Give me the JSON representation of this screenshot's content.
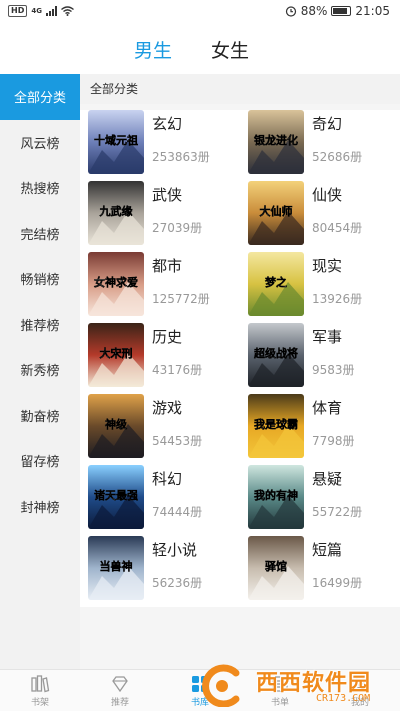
{
  "status_bar": {
    "hd": "HD",
    "network": "4G",
    "battery": "88%",
    "time": "21:05"
  },
  "gender_tabs": [
    {
      "label": "男生",
      "active": true
    },
    {
      "label": "女生",
      "active": false
    }
  ],
  "rail": {
    "items": [
      {
        "label": "全部分类",
        "active": true
      },
      {
        "label": "风云榜"
      },
      {
        "label": "热搜榜"
      },
      {
        "label": "完结榜"
      },
      {
        "label": "畅销榜"
      },
      {
        "label": "推荐榜"
      },
      {
        "label": "新秀榜"
      },
      {
        "label": "勤奋榜"
      },
      {
        "label": "留存榜"
      },
      {
        "label": "封神榜"
      }
    ]
  },
  "section_title": "全部分类",
  "categories": [
    {
      "name": "玄幻",
      "count": "253863册",
      "cover_title": "十域元祖",
      "colors": [
        "#2a3a6a",
        "#6d7fb8",
        "#c9d3f0"
      ]
    },
    {
      "name": "奇幻",
      "count": "52686册",
      "cover_title": "银龙进化",
      "colors": [
        "#2c2f3a",
        "#7a6a52",
        "#d9c39a"
      ]
    },
    {
      "name": "武侠",
      "count": "27039册",
      "cover_title": "九武缘",
      "colors": [
        "#e9e4d8",
        "#a9a39a",
        "#333333"
      ]
    },
    {
      "name": "仙侠",
      "count": "80454册",
      "cover_title": "大仙师",
      "colors": [
        "#3a2a20",
        "#c98c3a",
        "#f3d17a"
      ]
    },
    {
      "name": "都市",
      "count": "125772册",
      "cover_title": "女神求爱",
      "colors": [
        "#f7e6dc",
        "#d79c86",
        "#7a3b34"
      ]
    },
    {
      "name": "现实",
      "count": "13926册",
      "cover_title": "梦之",
      "colors": [
        "#6b8a2e",
        "#d7c242",
        "#f4e7a0"
      ]
    },
    {
      "name": "历史",
      "count": "43176册",
      "cover_title": "大宋刑",
      "colors": [
        "#f3ead8",
        "#b43a2a",
        "#3a2418"
      ]
    },
    {
      "name": "军事",
      "count": "9583册",
      "cover_title": "超级战将",
      "colors": [
        "#1e2228",
        "#5b636e",
        "#c4c8cc"
      ]
    },
    {
      "name": "游戏",
      "count": "54453册",
      "cover_title": "神级",
      "colors": [
        "#1e1d22",
        "#6a4a2a",
        "#e0a24a"
      ]
    },
    {
      "name": "体育",
      "count": "7798册",
      "cover_title": "我是球霸",
      "colors": [
        "#f3c63a",
        "#e7a824",
        "#4a3a1a"
      ]
    },
    {
      "name": "科幻",
      "count": "74444册",
      "cover_title": "诸天最强道长",
      "colors": [
        "#0c1a3a",
        "#1f4c8a",
        "#8ad0ff"
      ]
    },
    {
      "name": "悬疑",
      "count": "55722册",
      "cover_title": "我的有神",
      "colors": [
        "#23383c",
        "#5a8a88",
        "#cfe6df"
      ]
    },
    {
      "name": "轻小说",
      "count": "56236册",
      "cover_title": "当兽神",
      "colors": [
        "#e8eef5",
        "#9fb4cc",
        "#2a3a55"
      ]
    },
    {
      "name": "短篇",
      "count": "16499册",
      "cover_title": "驿馆",
      "colors": [
        "#f4f1ec",
        "#c7bcae",
        "#6a5848"
      ]
    }
  ],
  "bottom_nav": [
    {
      "label": "书架",
      "icon": "bookshelf-icon",
      "active": false
    },
    {
      "label": "推荐",
      "icon": "diamond-icon",
      "active": false
    },
    {
      "label": "书库",
      "icon": "grid-icon",
      "active": true
    },
    {
      "label": "书单",
      "icon": "list-icon",
      "active": false
    },
    {
      "label": "我的",
      "icon": "user-icon",
      "active": false
    }
  ],
  "watermark": {
    "title": "西西软件园",
    "url": "CR173.COM"
  },
  "accent_color": "#1a9ae0"
}
